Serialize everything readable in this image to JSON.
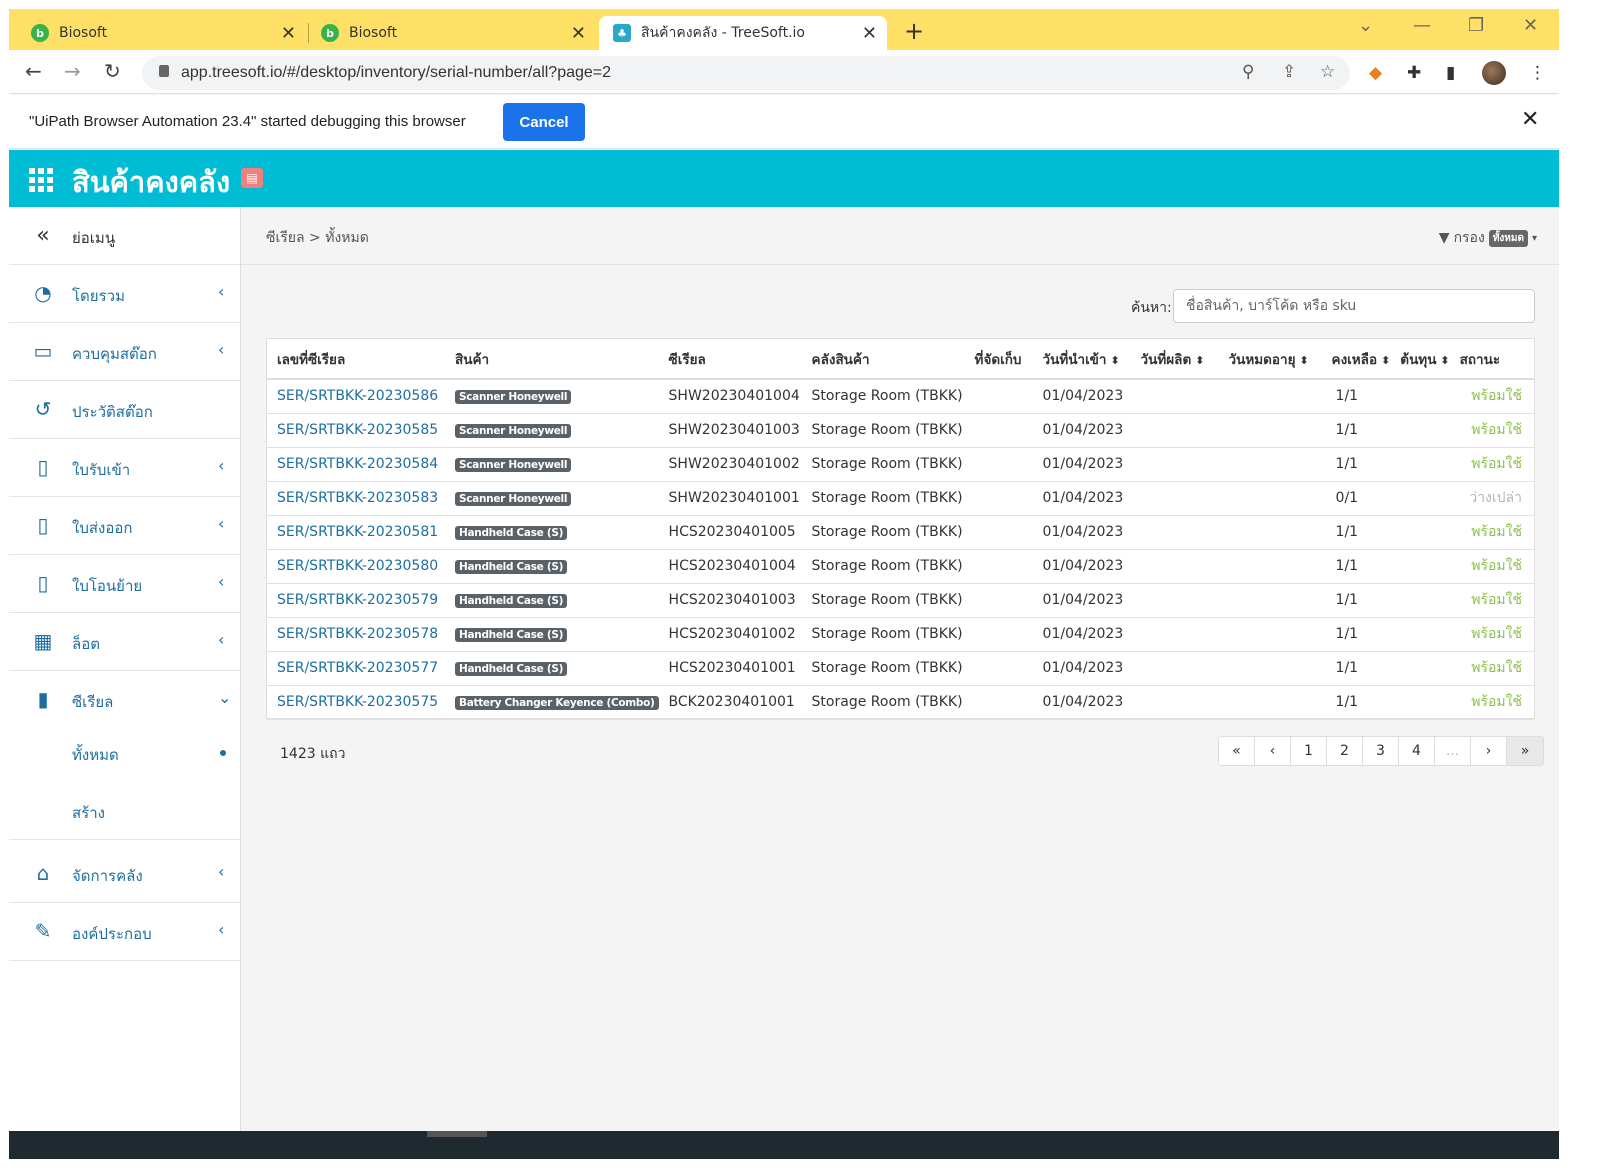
{
  "browser": {
    "tabs": [
      {
        "title": "Biosoft",
        "icon": "biosoft-favicon"
      },
      {
        "title": "Biosoft",
        "icon": "biosoft-favicon"
      },
      {
        "title": "สินค้าคงคลัง - TreeSoft.io",
        "icon": "treesoft-favicon"
      }
    ],
    "url": "app.treesoft.io/#/desktop/inventory/serial-number/all?page=2",
    "infobar_message": "\"UiPath Browser Automation 23.4\" started debugging this browser",
    "infobar_cancel": "Cancel"
  },
  "app": {
    "title": "สินค้าคงคลัง",
    "accent": "#00bcd4"
  },
  "sidebar": {
    "collapse_label": "ย่อเมนู",
    "items": [
      {
        "label": "โดยรวม",
        "icon": "dashboard-icon"
      },
      {
        "label": "ควบคุมสต๊อก",
        "icon": "box-icon"
      },
      {
        "label": "ประวัติสต๊อก",
        "icon": "history-icon"
      },
      {
        "label": "ใบรับเข้า",
        "icon": "document-icon"
      },
      {
        "label": "ใบส่งออก",
        "icon": "document-icon"
      },
      {
        "label": "ใบโอนย้าย",
        "icon": "document-icon"
      },
      {
        "label": "ล็อต",
        "icon": "pallet-icon"
      },
      {
        "label": "ซีเรียล",
        "icon": "sd-card-icon"
      },
      {
        "label": "จัดการคลัง",
        "icon": "warehouse-icon"
      },
      {
        "label": "องค์ประกอบ",
        "icon": "wrench-icon"
      }
    ],
    "sub_items": [
      {
        "label": "ทั้งหมด"
      },
      {
        "label": "สร้าง"
      }
    ]
  },
  "main": {
    "breadcrumb": "ซีเรียล > ทั้งหมด",
    "filter_label": "กรอง",
    "filter_badge": "ทั้งหมด",
    "search_label": "ค้นหา:",
    "search_placeholder": "ชื่อสินค้า, บาร์โค้ด หรือ sku",
    "columns": [
      "เลขที่ซีเรียล",
      "สินค้า",
      "ซีเรียล",
      "คลังสินค้า",
      "ที่จัดเก็บ",
      "วันที่นำเข้า",
      "วันที่ผลิต",
      "วันหมดอายุ",
      "คงเหลือ",
      "ต้นทุน",
      "สถานะ"
    ],
    "rows": [
      {
        "doc": "SER/SRTBKK-20230586",
        "product": "Scanner Honeywell",
        "serial": "SHW20230401004",
        "warehouse": "Storage Room (TBKK)",
        "location": "",
        "import_date": "01/04/2023",
        "mfg_date": "",
        "exp_date": "",
        "remaining": "1/1",
        "cost": "",
        "status": "พร้อมใช้"
      },
      {
        "doc": "SER/SRTBKK-20230585",
        "product": "Scanner Honeywell",
        "serial": "SHW20230401003",
        "warehouse": "Storage Room (TBKK)",
        "location": "",
        "import_date": "01/04/2023",
        "mfg_date": "",
        "exp_date": "",
        "remaining": "1/1",
        "cost": "",
        "status": "พร้อมใช้"
      },
      {
        "doc": "SER/SRTBKK-20230584",
        "product": "Scanner Honeywell",
        "serial": "SHW20230401002",
        "warehouse": "Storage Room (TBKK)",
        "location": "",
        "import_date": "01/04/2023",
        "mfg_date": "",
        "exp_date": "",
        "remaining": "1/1",
        "cost": "",
        "status": "พร้อมใช้"
      },
      {
        "doc": "SER/SRTBKK-20230583",
        "product": "Scanner Honeywell",
        "serial": "SHW20230401001",
        "warehouse": "Storage Room (TBKK)",
        "location": "",
        "import_date": "01/04/2023",
        "mfg_date": "",
        "exp_date": "",
        "remaining": "0/1",
        "cost": "",
        "status": "ว่างเปล่า"
      },
      {
        "doc": "SER/SRTBKK-20230581",
        "product": "Handheld Case (S)",
        "serial": "HCS20230401005",
        "warehouse": "Storage Room (TBKK)",
        "location": "",
        "import_date": "01/04/2023",
        "mfg_date": "",
        "exp_date": "",
        "remaining": "1/1",
        "cost": "",
        "status": "พร้อมใช้"
      },
      {
        "doc": "SER/SRTBKK-20230580",
        "product": "Handheld Case (S)",
        "serial": "HCS20230401004",
        "warehouse": "Storage Room (TBKK)",
        "location": "",
        "import_date": "01/04/2023",
        "mfg_date": "",
        "exp_date": "",
        "remaining": "1/1",
        "cost": "",
        "status": "พร้อมใช้"
      },
      {
        "doc": "SER/SRTBKK-20230579",
        "product": "Handheld Case (S)",
        "serial": "HCS20230401003",
        "warehouse": "Storage Room (TBKK)",
        "location": "",
        "import_date": "01/04/2023",
        "mfg_date": "",
        "exp_date": "",
        "remaining": "1/1",
        "cost": "",
        "status": "พร้อมใช้"
      },
      {
        "doc": "SER/SRTBKK-20230578",
        "product": "Handheld Case (S)",
        "serial": "HCS20230401002",
        "warehouse": "Storage Room (TBKK)",
        "location": "",
        "import_date": "01/04/2023",
        "mfg_date": "",
        "exp_date": "",
        "remaining": "1/1",
        "cost": "",
        "status": "พร้อมใช้"
      },
      {
        "doc": "SER/SRTBKK-20230577",
        "product": "Handheld Case (S)",
        "serial": "HCS20230401001",
        "warehouse": "Storage Room (TBKK)",
        "location": "",
        "import_date": "01/04/2023",
        "mfg_date": "",
        "exp_date": "",
        "remaining": "1/1",
        "cost": "",
        "status": "พร้อมใช้"
      },
      {
        "doc": "SER/SRTBKK-20230575",
        "product": "Battery Changer Keyence (Combo)",
        "serial": "BCK20230401001",
        "warehouse": "Storage Room (TBKK)",
        "location": "",
        "import_date": "01/04/2023",
        "mfg_date": "",
        "exp_date": "",
        "remaining": "1/1",
        "cost": "",
        "status": "พร้อมใช้"
      }
    ],
    "row_count": "1423 แถว",
    "pagination": [
      "«",
      "‹",
      "1",
      "2",
      "3",
      "4",
      "...",
      "›",
      "»"
    ],
    "status_colors": {
      "ready": "#8bc34a",
      "empty": "#b5b5b5"
    }
  }
}
